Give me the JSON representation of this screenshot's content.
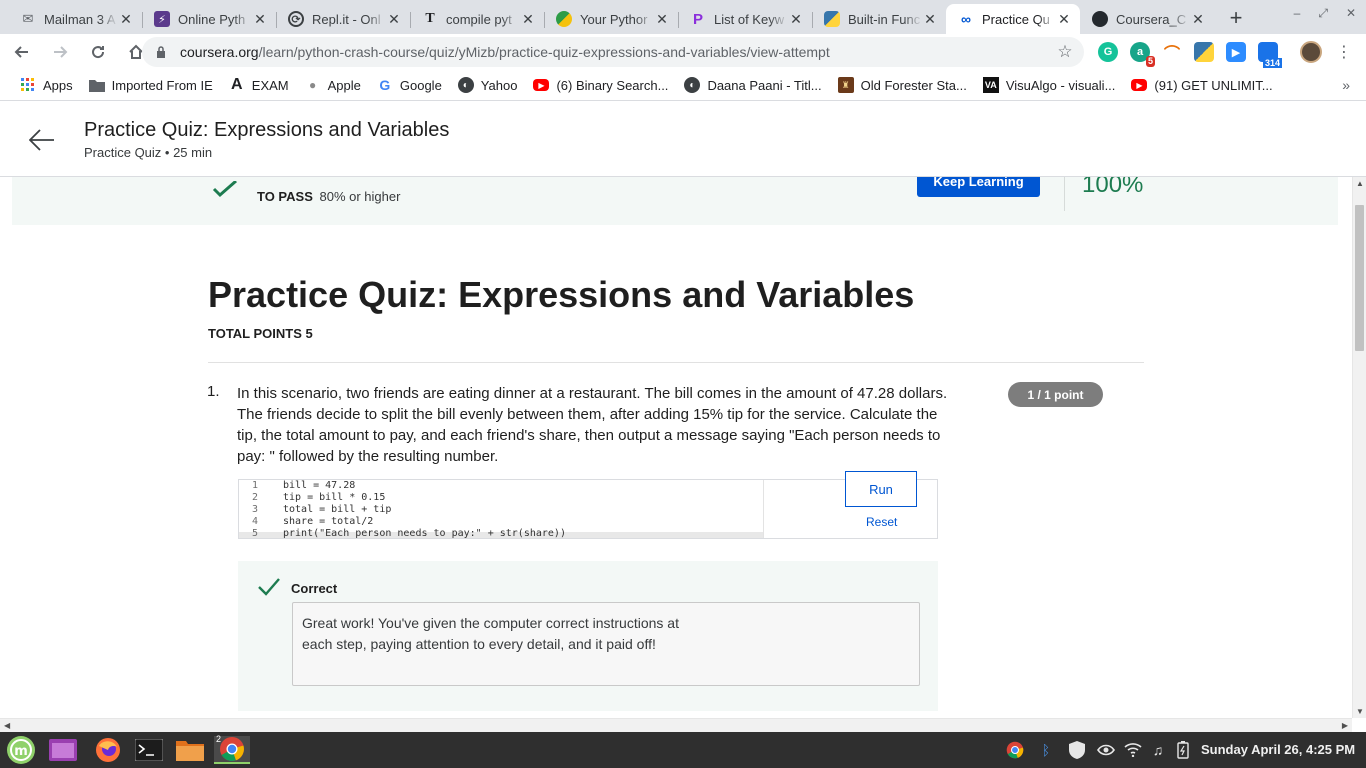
{
  "browser": {
    "tabs": [
      {
        "title": "Mailman 3 A",
        "favicon": "mailman-icon",
        "color": "#5f6368"
      },
      {
        "title": "Online Pyth",
        "favicon": "lightning-icon",
        "color": "#5b3a8c"
      },
      {
        "title": "Repl.it - Onl",
        "favicon": "replit-icon",
        "color": "#3c4043"
      },
      {
        "title": "compile pyt",
        "favicon": "t-icon",
        "color": "#202124"
      },
      {
        "title": "Your Pythor",
        "favicon": "python-green-icon",
        "color": "#2e9c47"
      },
      {
        "title": "List of Keyw",
        "favicon": "p-icon",
        "color": "#8b2fdb"
      },
      {
        "title": "Built-in Func",
        "favicon": "python-icon",
        "color": "#3776ab"
      },
      {
        "title": "Practice Qu",
        "favicon": "coursera-icon",
        "color": "#0056d2",
        "active": true
      },
      {
        "title": "Coursera_C",
        "favicon": "github-icon",
        "color": "#24292e"
      }
    ],
    "url_host": "coursera.org",
    "url_path": "/learn/python-crash-course/quiz/yMizb/practice-quiz-expressions-and-variables/view-attempt",
    "extensions": {
      "badge_count": "5",
      "meet_count": "314"
    },
    "bookmarks": [
      {
        "label": "Apps",
        "icon": "apps-grid-icon"
      },
      {
        "label": "Imported From IE",
        "icon": "folder-icon"
      },
      {
        "label": "EXAM",
        "icon": "a-logo-icon"
      },
      {
        "label": "Apple",
        "icon": "apple-icon"
      },
      {
        "label": "Google",
        "icon": "google-icon"
      },
      {
        "label": "Yahoo",
        "icon": "globe-icon"
      },
      {
        "label": "(6) Binary Search...",
        "icon": "youtube-icon"
      },
      {
        "label": "Daana Paani - Titl...",
        "icon": "globe-icon"
      },
      {
        "label": "Old Forester Sta...",
        "icon": "shield-icon"
      },
      {
        "label": "VisuAlgo - visuali...",
        "icon": "visualgo-icon"
      },
      {
        "label": "(91) GET UNLIMIT...",
        "icon": "youtube-icon"
      }
    ]
  },
  "header": {
    "title": "Practice Quiz: Expressions and Variables",
    "subtitle": "Practice Quiz • 25 min"
  },
  "banner": {
    "to_pass_label": "TO PASS",
    "to_pass_value": "80% or higher",
    "keep_learning": "Keep Learning",
    "score": "100%"
  },
  "quiz": {
    "title": "Practice Quiz: Expressions and Variables",
    "total_points": "TOTAL POINTS 5",
    "question": {
      "number": "1.",
      "text": "In this scenario, two friends are eating dinner at a restaurant. The bill comes in the amount of 47.28 dollars. The friends decide to split the bill evenly between them, after adding 15% tip for the service. Calculate the tip, the total amount to pay, and each friend's share, then output a message saying \"Each person needs to pay: \" followed by the resulting number.",
      "points": "1 / 1 point",
      "code_lines": [
        {
          "n": "1",
          "code": "bill = 47.28"
        },
        {
          "n": "2",
          "code": "tip = bill * 0.15"
        },
        {
          "n": "3",
          "code": "total = bill + tip"
        },
        {
          "n": "4",
          "code": "share = total/2"
        },
        {
          "n": "5",
          "code": "print(\"Each person needs to pay:\" + str(share))"
        }
      ],
      "run": "Run",
      "reset": "Reset",
      "feedback_status": "Correct",
      "feedback_text": "Great work! You've given the computer correct instructions at each step, paying attention to every detail, and it paid off!"
    }
  },
  "taskbar": {
    "clock": "Sunday April 26, 4:25 PM",
    "chrome_window_count": "2"
  }
}
